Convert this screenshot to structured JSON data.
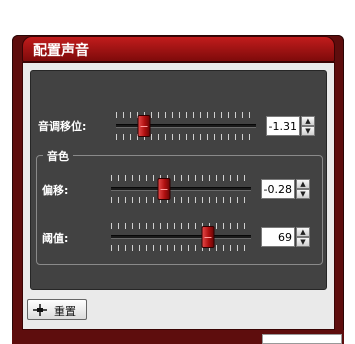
{
  "window": {
    "title": "配置声音"
  },
  "pitch": {
    "label": "音调移位:",
    "value": "-1.31",
    "position": 0.2
  },
  "timbre_group": {
    "title": "音色"
  },
  "offset": {
    "label": "偏移:",
    "value": "-0.28",
    "position": 0.38
  },
  "threshold": {
    "label": "阈值:",
    "value": "69",
    "position": 0.69
  },
  "reset_button": {
    "label": "重置"
  },
  "icons": {
    "up": "spin-up-arrow",
    "down": "spin-down-arrow",
    "reset": "reset-slider-icon"
  },
  "colors": {
    "accent": "#b01010",
    "panel": "#424242",
    "frame": "#5e0d0d"
  }
}
